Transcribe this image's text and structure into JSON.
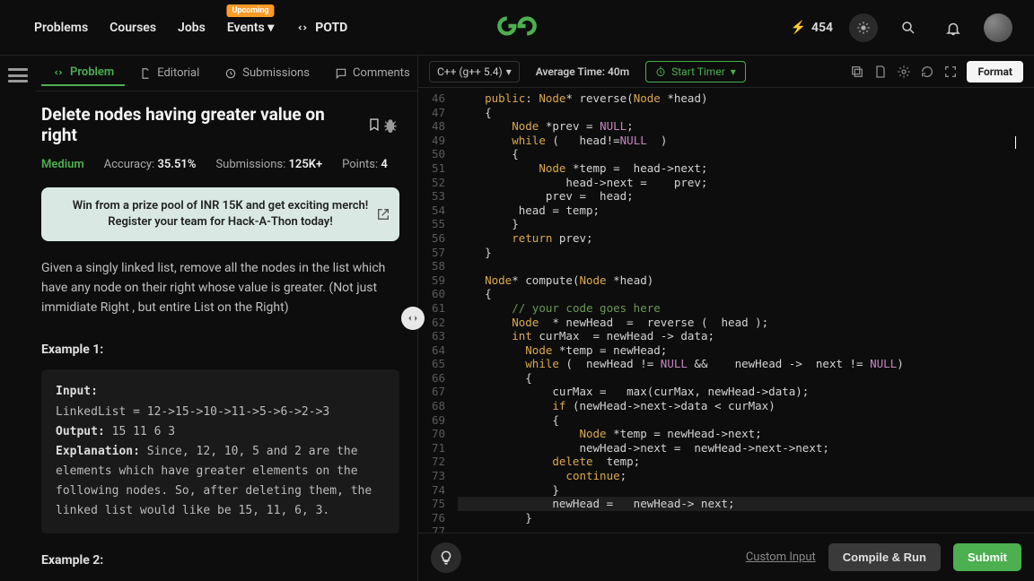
{
  "nav": {
    "items": [
      "Problems",
      "Courses",
      "Jobs",
      "Events"
    ],
    "events_badge": "Upcoming",
    "potd": "POTD",
    "streak": "454"
  },
  "tabs": {
    "problem": "Problem",
    "editorial": "Editorial",
    "submissions": "Submissions",
    "comments": "Comments"
  },
  "problem": {
    "title": "Delete nodes having greater value on right",
    "difficulty": "Medium",
    "accuracy_label": "Accuracy:",
    "accuracy_val": "35.51%",
    "submissions_label": "Submissions:",
    "submissions_val": "125K+",
    "points_label": "Points:",
    "points_val": "4",
    "promo": "Win from a prize pool of INR 15K and get exciting merch! Register your team for Hack-A-Thon today!",
    "description": "Given a singly linked list, remove all the nodes in the list which have any node on their right whose value is greater.  (Not just immidiate Right , but entire List on the Right)",
    "example1_h": "Example 1:",
    "example1_input_label": "Input:",
    "example1_input": "LinkedList = 12->15->10->11->5->6->2->3",
    "example1_output_label": "Output:",
    "example1_output": "15 11 6 3",
    "example1_expl_label": "Explanation:",
    "example1_expl": "Since, 12, 10, 5 and 2 are the elements which have greater elements on the following nodes. So, after deleting them, the linked list would like be 15, 11, 6, 3.",
    "example2_h": "Example 2:"
  },
  "editor": {
    "lang": "C++ (g++ 5.4)",
    "avg_time": "Average Time: 40m",
    "start_timer": "Start Timer",
    "format": "Format",
    "line_start": 46,
    "lines": [
      "    public: Node* reverse(Node *head)",
      "    {",
      "        Node *prev = NULL;",
      "        while (   head!=NULL  )",
      "        {",
      "            Node *temp =  head->next;",
      "                head->next =    prev;",
      "             prev =  head;",
      "         head = temp;",
      "        }",
      "        return prev;",
      "    }",
      "",
      "    Node* compute(Node *head)",
      "    {",
      "        // your code goes here",
      "        Node  * newHead  =  reverse (  head );",
      "        int curMax  = newHead -> data;",
      "          Node *temp = newHead;",
      "          while (  newHead != NULL &&    newHead ->  next != NULL)",
      "          {",
      "              curMax =   max(curMax, newHead->data);",
      "              if (newHead->next->data < curMax)",
      "              {",
      "                  Node *temp = newHead->next;",
      "                  newHead->next =  newHead->next->next;",
      "              delete  temp;",
      "                continue;",
      "              }",
      "              newHead =   newHead-> next;",
      "          }",
      ""
    ]
  },
  "bottom": {
    "custom_input": "Custom Input",
    "compile": "Compile & Run",
    "submit": "Submit"
  }
}
